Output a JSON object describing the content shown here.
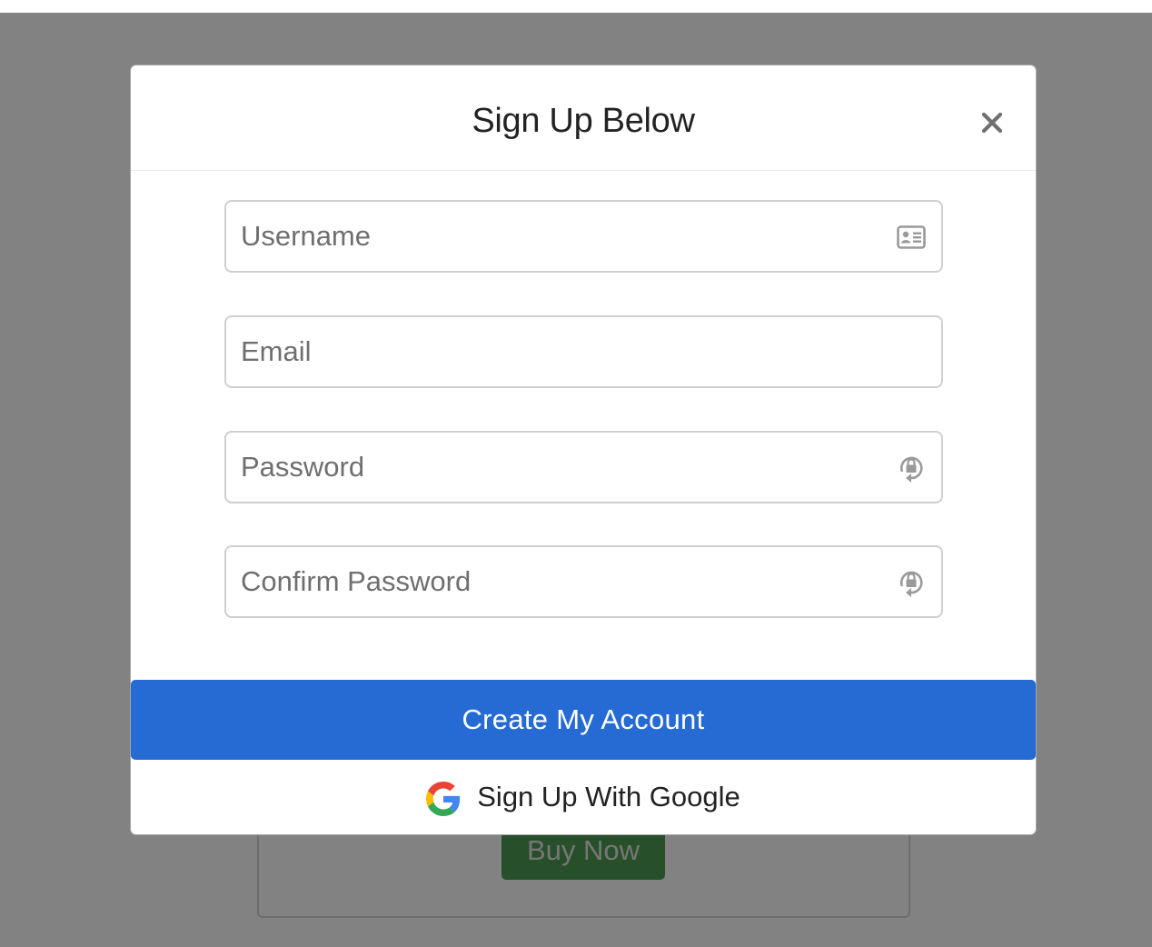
{
  "background_page": {
    "buy_button_label": "Buy Now"
  },
  "modal": {
    "title": "Sign Up Below",
    "close_icon": "close-icon",
    "fields": [
      {
        "placeholder": "Username",
        "value": "",
        "icon": "id-card-icon"
      },
      {
        "placeholder": "Email",
        "value": ""
      },
      {
        "placeholder": "Password",
        "value": "",
        "icon": "lock-reset-icon"
      },
      {
        "placeholder": "Confirm Password",
        "value": "",
        "icon": "lock-reset-icon"
      }
    ],
    "primary_button_label": "Create My Account",
    "google_button_label": "Sign Up With Google",
    "google_icon": "google-logo-icon"
  },
  "colors": {
    "primary": "#256bd3",
    "buy_button": "#4e9b51",
    "backdrop": "#808080"
  }
}
